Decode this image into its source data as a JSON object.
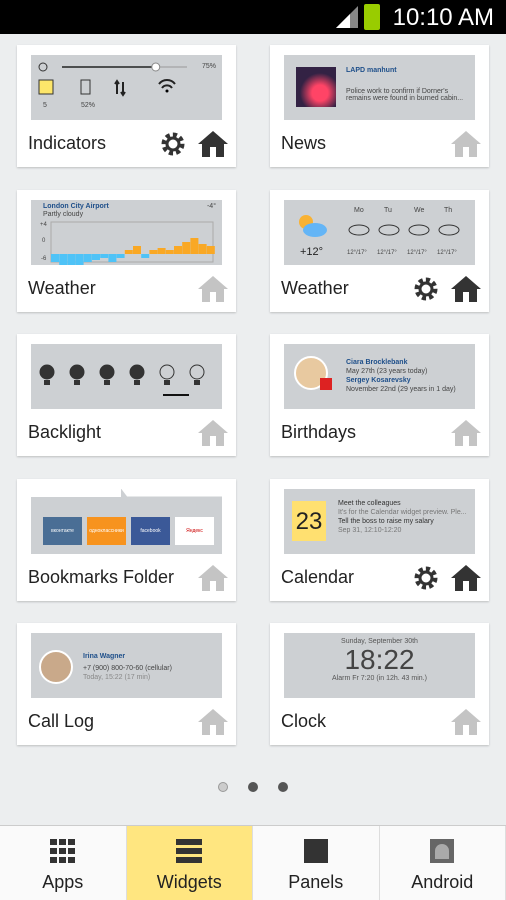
{
  "status_bar": {
    "time": "10:10 AM"
  },
  "widgets": [
    {
      "label": "Indicators",
      "settings": true,
      "home_active": true,
      "brightness": "75%",
      "brightness_level": 0.75,
      "timeout": "5",
      "battery": "52%"
    },
    {
      "label": "News",
      "settings": false,
      "home_active": false,
      "headline": "LAPD manhunt",
      "body": "Police work to confirm if Dorner's remains were found in burned cabin..."
    },
    {
      "label": "Weather",
      "settings": false,
      "home_active": false,
      "location": "London City Airport",
      "condition": "Partly cloudy",
      "temp": "-4°",
      "axis": [
        "+4",
        "0",
        "-6"
      ],
      "values": [
        -2,
        -3,
        -5,
        -3,
        -2,
        -1.5,
        -1,
        -2,
        -1,
        1,
        2,
        -1,
        1,
        1.5,
        1,
        2,
        3,
        4,
        2.5,
        2
      ]
    },
    {
      "label": "Weather",
      "settings": true,
      "home_active": true,
      "current": "+12°",
      "days": [
        {
          "d": "Mo",
          "t": "12°/17°"
        },
        {
          "d": "Tu",
          "t": "12°/17°"
        },
        {
          "d": "We",
          "t": "12°/17°"
        },
        {
          "d": "Th",
          "t": "12°/17°"
        }
      ]
    },
    {
      "label": "Backlight",
      "settings": false,
      "home_active": false
    },
    {
      "label": "Birthdays",
      "settings": false,
      "home_active": false,
      "people": [
        {
          "name": "Ciara Brocklebank",
          "date": "May 27th (23 years today)"
        },
        {
          "name": "Sergey Kosarevsky",
          "date": "November 22nd (29 years in 1 day)"
        }
      ]
    },
    {
      "label": "Bookmarks Folder",
      "settings": false,
      "home_active": false,
      "bookmarks": [
        "вконтакте",
        "одноклассники",
        "facebook",
        "Яндекс"
      ]
    },
    {
      "label": "Calendar",
      "settings": true,
      "home_active": true,
      "day": "23",
      "events": [
        {
          "title": "Meet the colleagues",
          "sub": "It's for the Calendar widget preview. Ple..."
        },
        {
          "title": "Tell the boss to raise my salary",
          "sub": "Sep 31, 12:10-12:20"
        }
      ]
    },
    {
      "label": "Call Log",
      "settings": false,
      "home_active": false,
      "name": "Irina Wagner",
      "number": "+7 (900) 800-70-60 (cellular)",
      "when": "Today, 15:22 (17 min)"
    },
    {
      "label": "Clock",
      "settings": false,
      "home_active": false,
      "date": "Sunday, September 30th",
      "time": "18:22",
      "alarm": "Alarm Fr 7:20 (in 12h. 43 min.)"
    }
  ],
  "pager": {
    "pages": 3,
    "current": 1
  },
  "nav": [
    {
      "label": "Apps",
      "icon": "grid-icon"
    },
    {
      "label": "Widgets",
      "icon": "widgets-icon",
      "selected": true
    },
    {
      "label": "Panels",
      "icon": "square-icon"
    },
    {
      "label": "Android",
      "icon": "android-icon"
    }
  ],
  "colors": {
    "selected_tab": "#ffe680",
    "bar_warm": "#f9a825",
    "bar_cold": "#4fc3f7"
  }
}
